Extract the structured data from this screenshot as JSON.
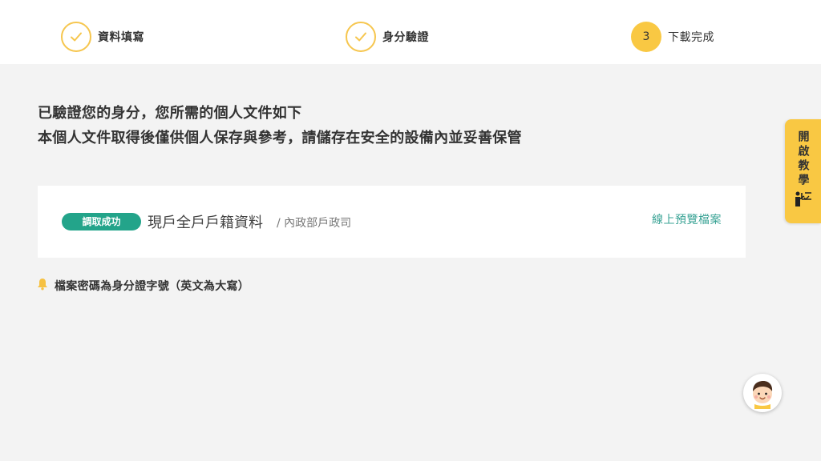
{
  "stepper": {
    "steps": [
      {
        "label": "資料填寫",
        "state": "done"
      },
      {
        "label": "身分驗證",
        "state": "done"
      },
      {
        "label": "下載完成",
        "state": "current",
        "number": "3"
      }
    ]
  },
  "intro": {
    "line1": "已驗證您的身分，您所需的個人文件如下",
    "line2": "本個人文件取得後僅供個人保存與參考，請儲存在安全的設備內並妥善保管"
  },
  "document": {
    "status_badge": "調取成功",
    "name": "現戶全戶戶籍資料",
    "source": "/ 內政部戶政司",
    "preview_link": "線上預覽檔案"
  },
  "notice": {
    "icon": "bell-icon",
    "text": "檔案密碼為身分證字號（英文為大寫）"
  },
  "tutorial": {
    "label": "開啟教學",
    "icon": "presentation-icon"
  },
  "assistant": {
    "icon": "assistant-avatar-icon"
  },
  "colors": {
    "accent_yellow": "#f9c843",
    "badge_green": "#23a48a",
    "link_teal": "#3aa395",
    "background": "#f3f3f3"
  }
}
